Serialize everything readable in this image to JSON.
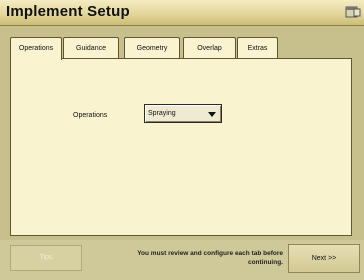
{
  "window": {
    "title": "Implement Setup",
    "title_icon": "window-icon"
  },
  "tabs": [
    {
      "label": "Operations",
      "active": true
    },
    {
      "label": "Guidance",
      "active": false
    },
    {
      "label": "Geometry",
      "active": false
    },
    {
      "label": "Overlap",
      "active": false
    },
    {
      "label": "Extras",
      "active": false
    }
  ],
  "operations": {
    "label": "Operations",
    "selected": "Spraying"
  },
  "footer": {
    "tips_label": "Tips",
    "message_line1": "You must review and configure each tab before",
    "message_line2": "continuing.",
    "next_label": "Next >>"
  },
  "colors": {
    "title_bar": "#e3d79b",
    "panel_bg": "#f9f3cf",
    "window_bg": "#c7c08d"
  }
}
